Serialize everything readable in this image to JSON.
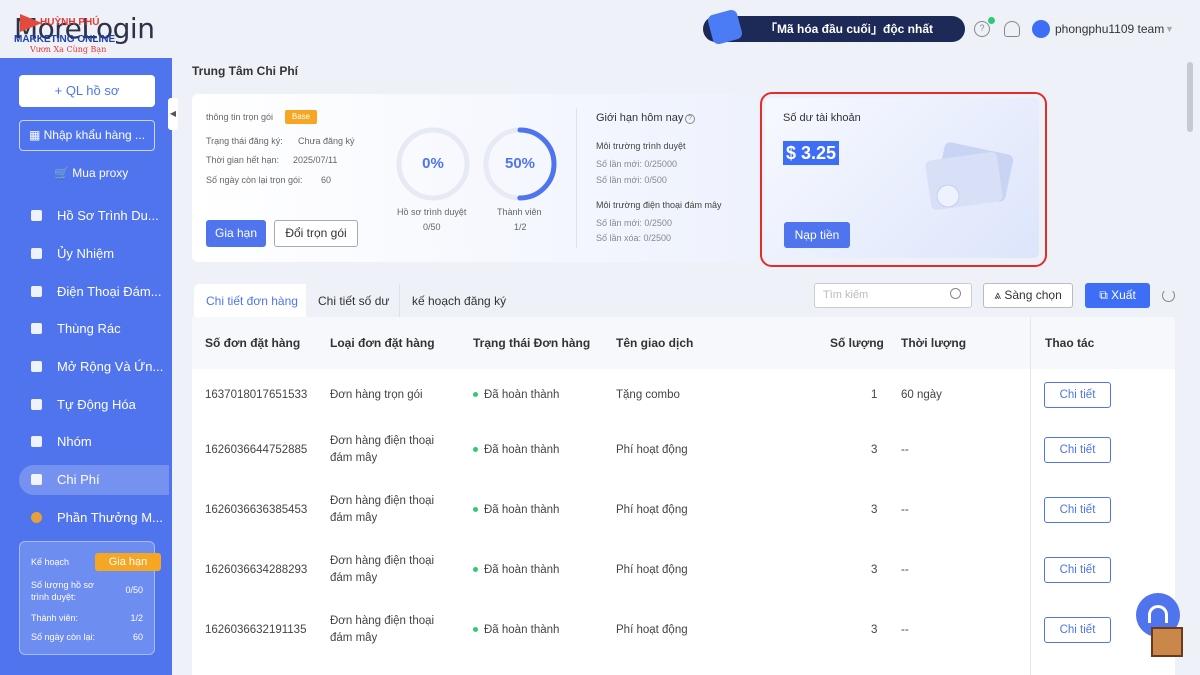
{
  "app": {
    "name": "MoreLogin"
  },
  "watermark": {
    "line1": "HUỲNH PHÚ",
    "line2": "MARKETING ONLINE",
    "line3": "Vươn Xa Cùng Bạn"
  },
  "header": {
    "banner": "「Mã hóa đầu cuối」độc nhất",
    "username": "phongphu1109 team"
  },
  "sidebar": {
    "new_profile": "+ QL hồ sơ",
    "import": "Nhập khẩu hàng ...",
    "proxy": "Mua proxy",
    "items": [
      {
        "label": "Hồ Sơ Trình Du...",
        "icon": "browser-icon"
      },
      {
        "label": "Ủy Nhiệm",
        "icon": "delegate-icon"
      },
      {
        "label": "Điện Thoại Đám...",
        "icon": "phone-icon"
      },
      {
        "label": "Thùng Rác",
        "icon": "trash-icon"
      },
      {
        "label": "Mở Rộng Và Ứn...",
        "icon": "extension-icon"
      },
      {
        "label": "Tự Động Hóa",
        "icon": "automation-icon"
      },
      {
        "label": "Nhóm",
        "icon": "group-icon"
      },
      {
        "label": "Chi Phí",
        "icon": "cost-icon"
      },
      {
        "label": "Phần Thưởng M...",
        "icon": "reward-icon"
      }
    ],
    "plan": {
      "title": "Kế hoạch",
      "renew": "Gia hạn",
      "profiles_label": "Số lượng hồ sơ trình duyệt:",
      "profiles_value": "0/50",
      "members_label": "Thành viên:",
      "members_value": "1/2",
      "days_label": "Số ngày còn lại:",
      "days_value": "60"
    }
  },
  "page": {
    "title": "Trung Tâm Chi Phí"
  },
  "package": {
    "title": "thông tin trọn gói",
    "badge": "Base",
    "reg_status_label": "Trạng thái đăng ký:",
    "reg_status_value": "Chưa đăng ký",
    "expiry_label": "Thời gian hết hạn:",
    "expiry_value": "2025/07/11",
    "days_label": "Số ngày còn lại trọn gói:",
    "days_value": "60",
    "renew": "Gia hạn",
    "change": "Đổi trọn gói",
    "gauge1": {
      "value": "0%",
      "fraction": 0,
      "label": "Hồ sơ trình duyệt",
      "sub": "0/50"
    },
    "gauge2": {
      "value": "50%",
      "fraction": 0.5,
      "label": "Thành viên",
      "sub": "1/2"
    }
  },
  "limits": {
    "title": "Giới hạn hôm nay",
    "browser_env": "Môi trường trình duyệt",
    "browser_new1": "Số lần mới: 0/25000",
    "browser_new2": "Số lần mới: 0/500",
    "cloud_env": "Môi trường điện thoại đám mây",
    "cloud_new": "Số lần mới: 0/2500",
    "cloud_del": "Số lần xóa: 0/2500"
  },
  "balance": {
    "title": "Số dư tài khoản",
    "amount": "$ 3.25",
    "topup": "Nạp tiền"
  },
  "tabs": [
    "Chi tiết đơn hàng",
    "Chi tiết số dư",
    "kế hoạch đăng ký"
  ],
  "toolbar": {
    "search_placeholder": "Tìm kiếm",
    "filter": "Sàng chọn",
    "export": "Xuất"
  },
  "table": {
    "headers": [
      "Số đơn đặt hàng",
      "Loại đơn đặt hàng",
      "Trạng thái Đơn hàng",
      "Tên giao dịch",
      "Số lượng",
      "Thời lượng",
      "Thao tác"
    ],
    "detail_btn": "Chi tiết",
    "rows": [
      {
        "id": "1637018017651533",
        "type1": "Đơn hàng trọn gói",
        "type2": "",
        "status": "Đã hoàn thành",
        "name": "Tặng combo",
        "qty": "1",
        "duration": "60 ngày"
      },
      {
        "id": "1626036644752885",
        "type1": "Đơn hàng điện thoại",
        "type2": "đám mây",
        "status": "Đã hoàn thành",
        "name": "Phí hoạt động",
        "qty": "3",
        "duration": "--"
      },
      {
        "id": "1626036636385453",
        "type1": "Đơn hàng điện thoại",
        "type2": "đám mây",
        "status": "Đã hoàn thành",
        "name": "Phí hoạt động",
        "qty": "3",
        "duration": "--"
      },
      {
        "id": "1626036634288293",
        "type1": "Đơn hàng điện thoại",
        "type2": "đám mây",
        "status": "Đã hoàn thành",
        "name": "Phí hoạt động",
        "qty": "3",
        "duration": "--"
      },
      {
        "id": "1626036632191135",
        "type1": "Đơn hàng điện thoại",
        "type2": "đám mây",
        "status": "Đã hoàn thành",
        "name": "Phí hoạt động",
        "qty": "3",
        "duration": "--"
      }
    ]
  },
  "colors": {
    "primary": "#4f74ee",
    "sidebar": "#4f74ee",
    "highlight": "#e12d2d",
    "success": "#2ecc71",
    "badge": "#f5a623"
  }
}
